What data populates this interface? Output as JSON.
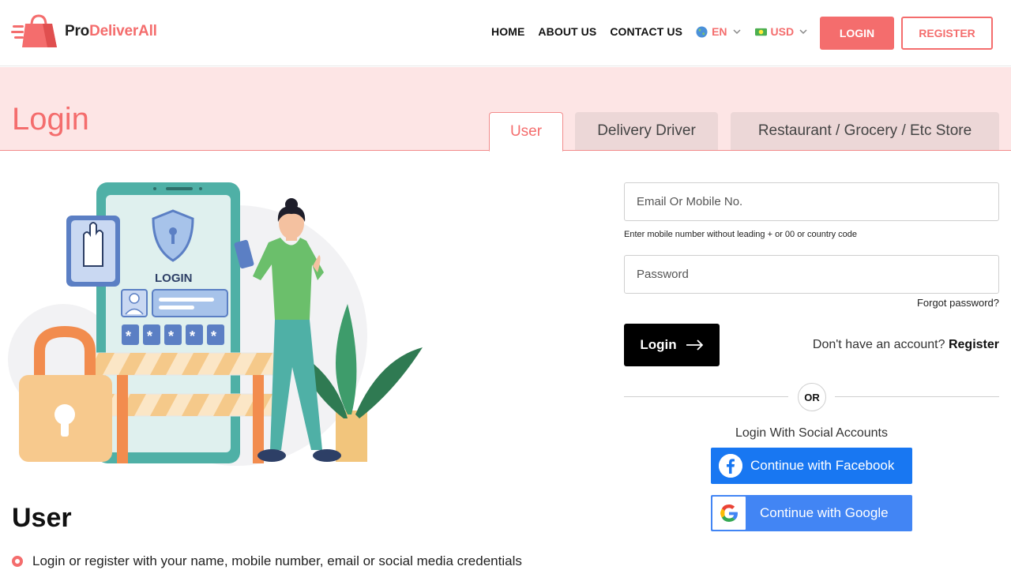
{
  "brand": {
    "name_part1": "Pro",
    "name_part2": "DeliverAll"
  },
  "nav": {
    "items": [
      "HOME",
      "ABOUT US",
      "CONTACT US"
    ],
    "language": "EN",
    "currency": "USD",
    "login_label": "LOGIN",
    "register_label": "REGISTER"
  },
  "banner": {
    "title": "Login",
    "tabs": [
      {
        "label": "User",
        "active": true
      },
      {
        "label": "Delivery Driver",
        "active": false
      },
      {
        "label": "Restaurant / Grocery / Etc Store",
        "active": false
      }
    ]
  },
  "illustration": {
    "screen_label": "LOGIN"
  },
  "content": {
    "heading": "User",
    "bullets": [
      "Login or register with your name, mobile number, email or social media credentials"
    ]
  },
  "form": {
    "email_placeholder": "Email Or Mobile No.",
    "email_hint": "Enter mobile number without leading + or 00 or country code",
    "password_placeholder": "Password",
    "forgot_label": "Forgot password?",
    "login_label": "Login",
    "no_account_text": "Don't have an account?",
    "register_link": "Register",
    "or_label": "OR",
    "social_title": "Login With Social Accounts",
    "facebook_label": "Continue with Facebook",
    "google_label": "Continue with Google"
  },
  "colors": {
    "accent": "#f46d6d",
    "banner_bg": "#fde5e5",
    "facebook": "#1877f2",
    "google": "#4285f4"
  }
}
